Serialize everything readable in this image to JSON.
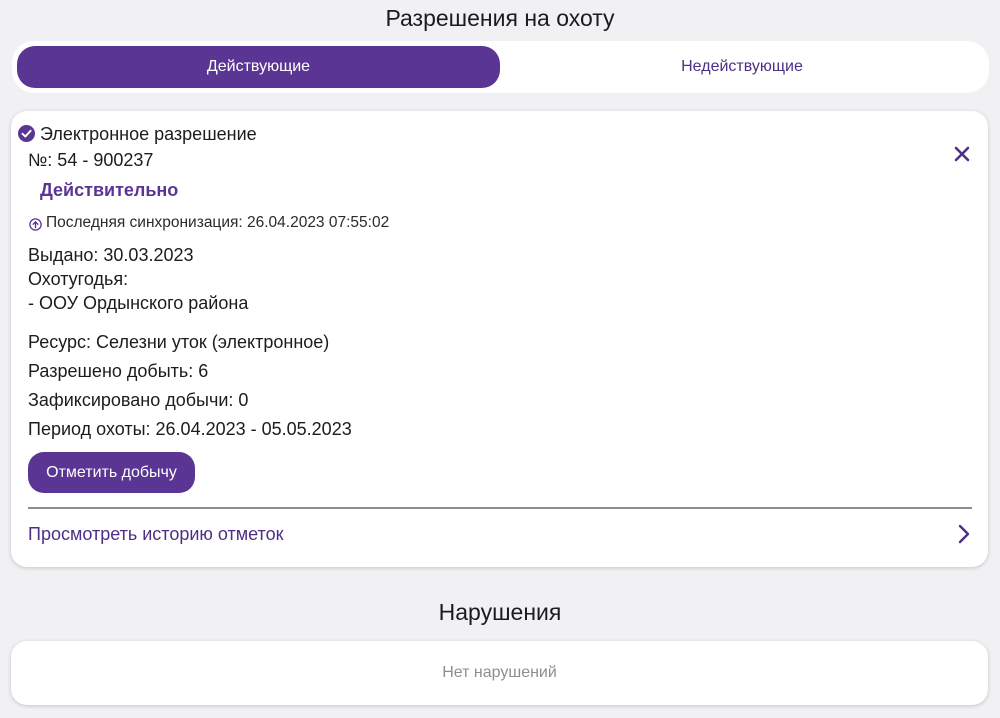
{
  "header": {
    "title": "Разрешения на охоту"
  },
  "tabs": [
    {
      "label": "Действующие",
      "active": true
    },
    {
      "label": "Недействующие",
      "active": false
    }
  ],
  "permit": {
    "type": "Электронное разрешение",
    "number": "№: 54 - 900237",
    "status": "Действительно",
    "sync": "Последняя синхронизация: 26.04.2023 07:55:02",
    "issued": "Выдано: 30.03.2023",
    "grounds_label": "Охотугодья:",
    "grounds_item": "- ООУ Ордынского района",
    "resource": "Ресурс: Селезни уток (электронное)",
    "allowed": "Разрешено добыть: 6",
    "recorded": "Зафиксировано добычи: 0",
    "period": "Период охоты: 26.04.2023 - 05.05.2023",
    "mark_button": "Отметить добычу",
    "history_link": "Просмотреть историю отметок"
  },
  "violations": {
    "title": "Нарушения",
    "empty": "Нет нарушений"
  },
  "colors": {
    "accent": "#5a3594",
    "background": "#f1f1f3",
    "muted": "#8e8e92"
  },
  "icons": [
    "check-circle-icon",
    "close-icon",
    "sync-icon",
    "chevron-right-icon"
  ]
}
